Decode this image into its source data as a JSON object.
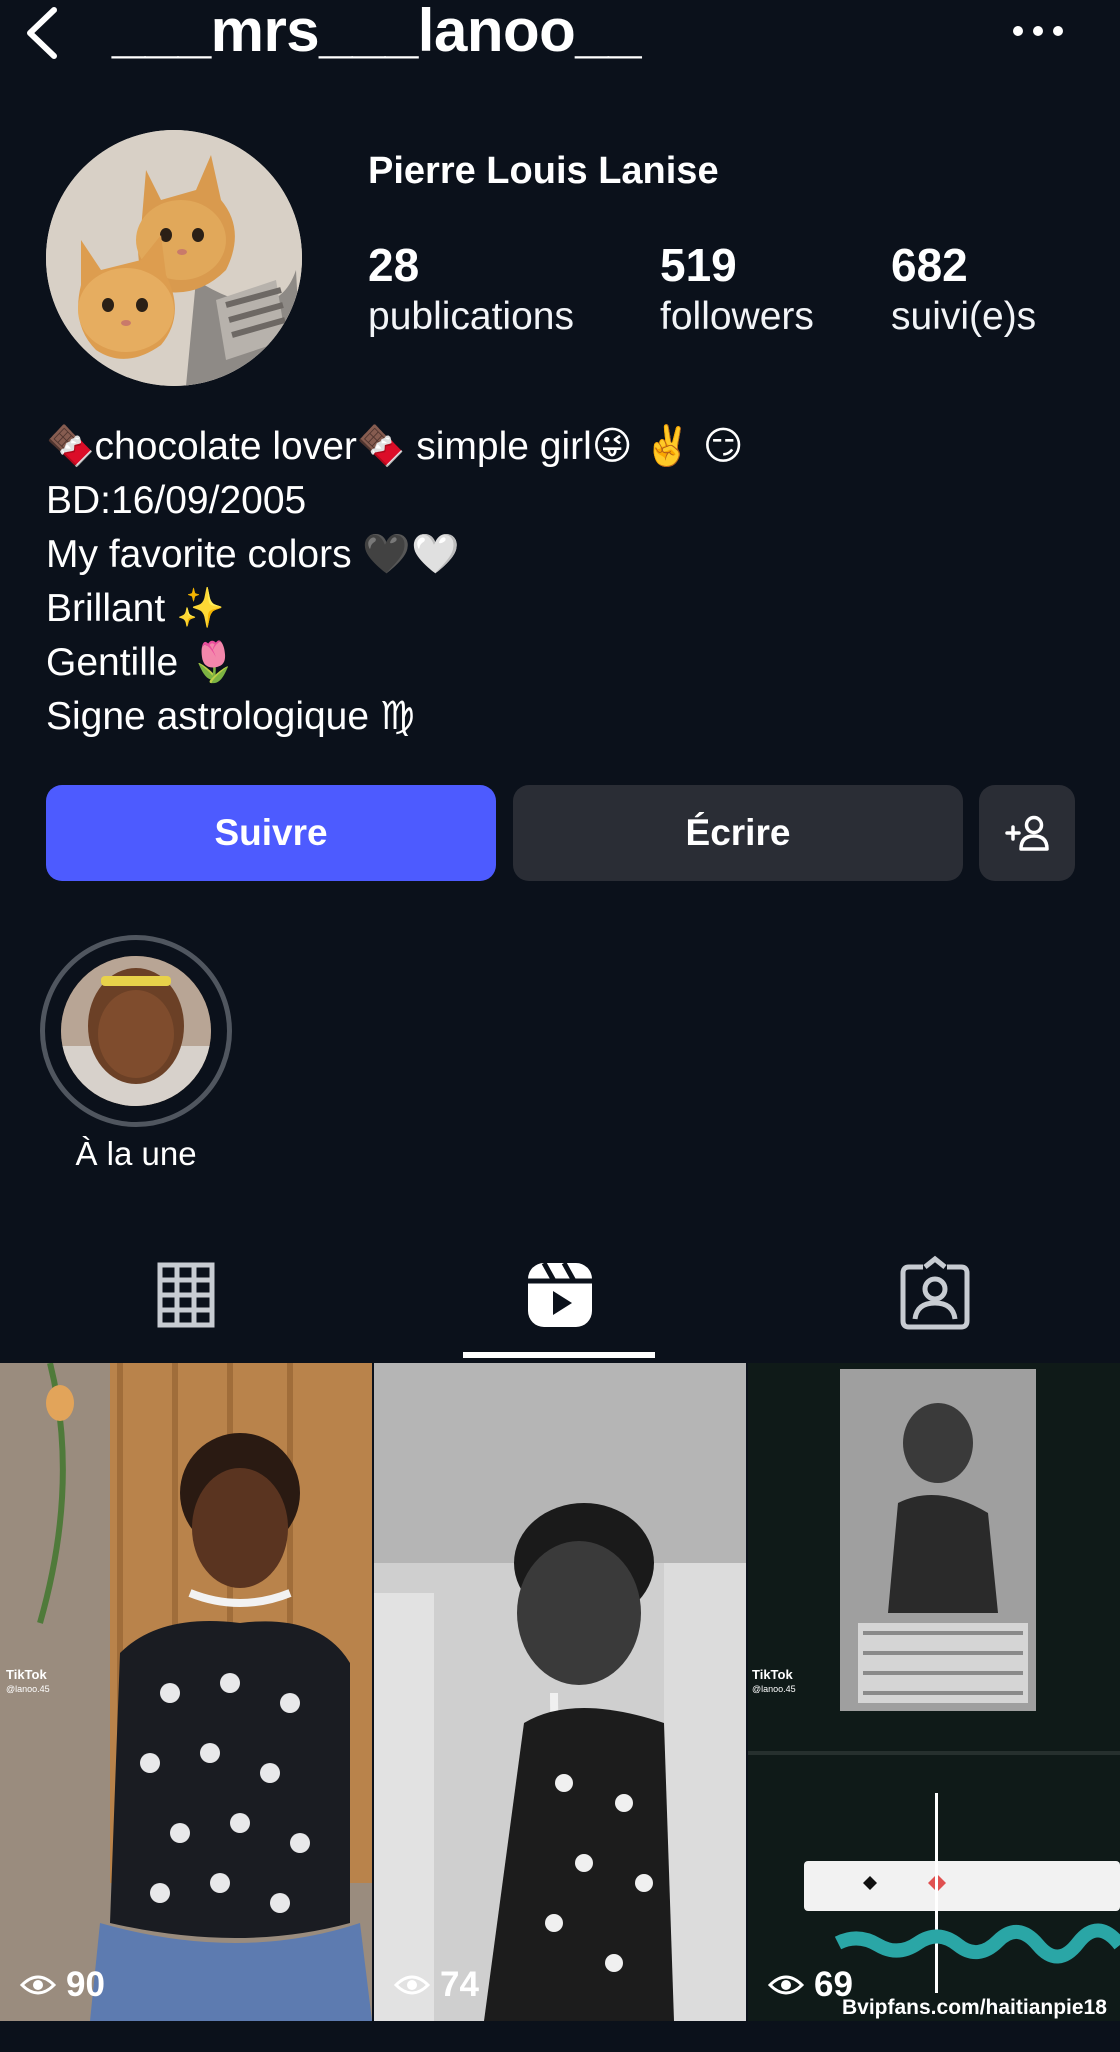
{
  "header": {
    "username": "___mrs___lanoo__",
    "back_icon": "chevron-left-icon",
    "more_icon": "more-horizontal-icon"
  },
  "profile": {
    "full_name": "Pierre Louis Lanise",
    "stats": [
      {
        "value": "28",
        "label": "publications"
      },
      {
        "value": "519",
        "label": "followers"
      },
      {
        "value": "682",
        "label": "suivi(e)s"
      }
    ],
    "bio": [
      "🍫chocolate lover🍫 simple girl😜 ✌️ 😏",
      "BD:16/09/2005",
      "My favorite colors 🖤🤍",
      "Brillant ✨",
      "Gentille 🌷",
      "Signe astrologique ♍"
    ]
  },
  "actions": {
    "follow_label": "Suivre",
    "message_label": "Écrire",
    "add_user_icon": "add-user-icon",
    "follow_color": "#4d5bff",
    "secondary_color": "#2a2d35"
  },
  "highlights": [
    {
      "label": "À la une"
    }
  ],
  "tabs": [
    {
      "name": "grid",
      "icon": "grid-icon"
    },
    {
      "name": "reels",
      "icon": "reels-icon",
      "active": true
    },
    {
      "name": "tagged",
      "icon": "tagged-icon"
    }
  ],
  "posts": [
    {
      "views": "90",
      "overlay": "TikTok",
      "handle": "@lanoo.45"
    },
    {
      "views": "74"
    },
    {
      "views": "69",
      "overlay": "TikTok",
      "handle": "@lanoo.45"
    }
  ],
  "watermark": "Bvipfans.com/haitianpie18",
  "colors": {
    "background": "#0b111b",
    "text": "#ffffff"
  }
}
